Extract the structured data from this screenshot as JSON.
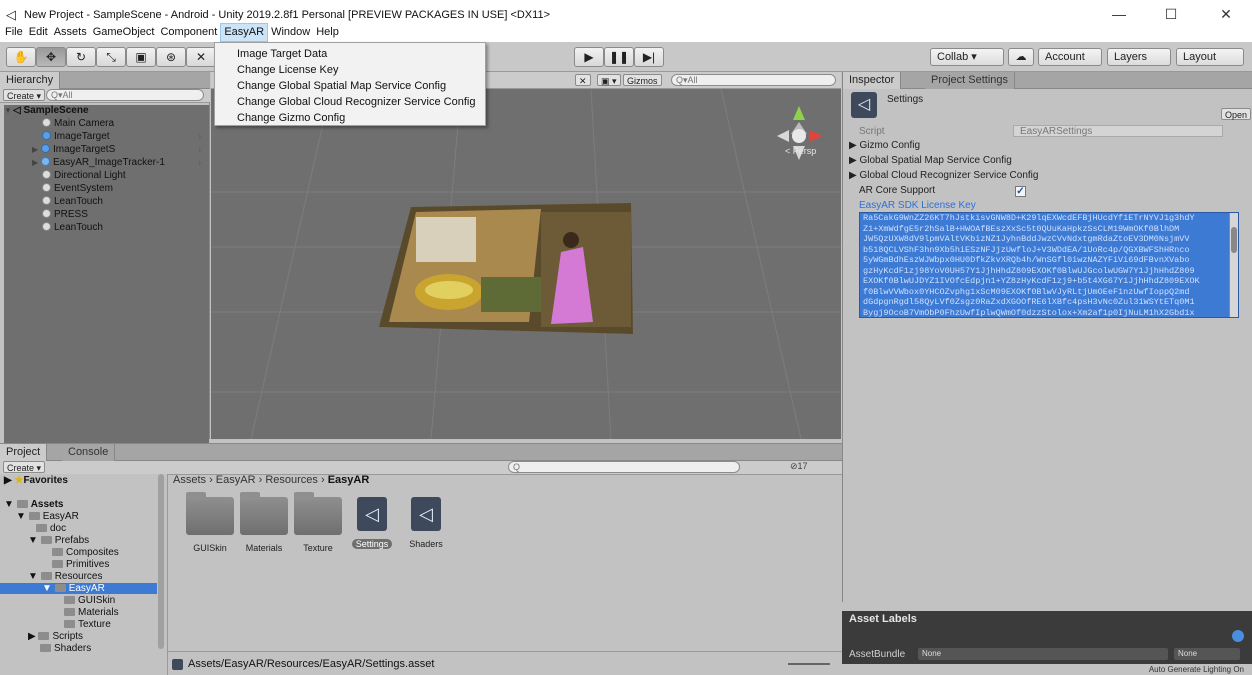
{
  "window": {
    "title": "New Project - SampleScene - Android - Unity 2019.2.8f1 Personal [PREVIEW PACKAGES IN USE] <DX11>",
    "minimize": "—",
    "maximize": "☐",
    "close": "✕"
  },
  "menubar": [
    "File",
    "Edit",
    "Assets",
    "GameObject",
    "Component",
    "EasyAR",
    "Window",
    "Help"
  ],
  "easyar_menu": [
    "Image Target Data",
    "Change License Key",
    "Change Global Spatial Map Service Config",
    "Change Global Cloud Recognizer Service Config",
    "Change Gizmo Config"
  ],
  "toolbar": {
    "collab": "Collab ▾",
    "account": "Account",
    "layers": "Layers",
    "layout": "Layout"
  },
  "hierarchy": {
    "tab": "Hierarchy",
    "create": "Create ▾",
    "search_placeholder": "Q▾All",
    "scene": "SampleScene",
    "items": [
      "Main Camera",
      "ImageTarget",
      "ImageTargetS",
      "EasyAR_ImageTracker-1",
      "Directional Light",
      "EventSystem",
      "LeanTouch",
      "PRESS",
      "LeanTouch"
    ]
  },
  "scene_view": {
    "gizmos": "Gizmos",
    "search_placeholder": "Q▾All",
    "persp": "< Persp"
  },
  "inspector": {
    "tab": "Inspector",
    "tab2": "Project Settings",
    "object_name": "Settings",
    "open": "Open",
    "script_label": "Script",
    "script_value": "EasyARSettings",
    "foldouts": [
      "Gizmo Config",
      "Global Spatial Map Service Config",
      "Global Cloud Recognizer Service Config"
    ],
    "ar_core_support": "AR Core Support",
    "license_label": "EasyAR SDK License Key",
    "license_lines": [
      "Ra5CakG9WnZZ26KT7hJstkisvGNW8D+K29lqEXWcdEFBjHUcdYf1ETrNYVJ1g3hdY",
      "Z1+XmWdfgE5r2hSalB+HWOAfBEszXxSc5t0QUuKaHpkzSsCLM19WmOKf0BlhDM",
      "JW5QzUXW8dV9lpmVAltVKbizNZ1JyhnBddJwzCVvNdxtgmRdaZtoEV3DM0NsjmVV",
      "b518QCLVShF3hn9Xb5hiESzNFJjzUwfloJ+V3WDdEA/1UoRc4p/QGXBWFShHRnco",
      "5yWGmBdhEszWJWbpx0HU0DfkZkvXRQb4h/WnSGfl0iwzNAZYFiVi69dFBvnXVabo",
      "gzHyKcdF1zj98YoV0UH57Y1JjhHhdZ809EXOKf0BlwUJGcolwUGW7Y1JjhHhdZ809",
      "EXOKf0BlwUJDYZ1IVOfcEdpjn1+YZ8zHyKcdF1zj9+b5t4XG67Y1JjhHhdZ809EXOK",
      "f0BlwVVWbox0YHCOZvphg1xScM09EXOKf0BlwVJyRLtjUmOEeF1nzUwfIoppQ2md",
      "dGdpgnRgdl58QyLVf0Zsgz0RaZxdXGOOfRE6lXBfc4psH3vNc0Zul31WSYtETq0M1",
      "Bygj9OcoB7VmObP0FhzUwfIplwQWmOf0dzzStolox+Xm2af1p0IjNuLM1hX2Gbd1x"
    ],
    "asset_labels": "Asset Labels",
    "asset_bundle": "AssetBundle",
    "asset_bundle_value": "None",
    "asset_bundle_variant": "None",
    "status": "Auto Generate Lighting On"
  },
  "project": {
    "tab": "Project",
    "tab2": "Console",
    "create": "Create ▾",
    "count": "17",
    "favorites": "Favorites",
    "tree": [
      {
        "label": "Assets",
        "level": 0,
        "bold": true,
        "arrow": "▼"
      },
      {
        "label": "EasyAR",
        "level": 1,
        "arrow": "▼"
      },
      {
        "label": "doc",
        "level": 2,
        "arrow": ""
      },
      {
        "label": "Prefabs",
        "level": 2,
        "arrow": "▼"
      },
      {
        "label": "Composites",
        "level": 3,
        "arrow": ""
      },
      {
        "label": "Primitives",
        "level": 3,
        "arrow": ""
      },
      {
        "label": "Resources",
        "level": 2,
        "arrow": "▼"
      },
      {
        "label": "EasyAR",
        "level": 3,
        "arrow": "▼",
        "selected": true
      },
      {
        "label": "GUISkin",
        "level": 4,
        "arrow": ""
      },
      {
        "label": "Materials",
        "level": 4,
        "arrow": ""
      },
      {
        "label": "Texture",
        "level": 4,
        "arrow": ""
      },
      {
        "label": "Scripts",
        "level": 2,
        "arrow": "▶"
      },
      {
        "label": "Shaders",
        "level": 2,
        "arrow": ""
      }
    ],
    "breadcrumb": [
      "Assets",
      "EasyAR",
      "Resources",
      "EasyAR"
    ],
    "assets": [
      {
        "label": "GUISkin",
        "kind": "folder"
      },
      {
        "label": "Materials",
        "kind": "folder"
      },
      {
        "label": "Texture",
        "kind": "folder"
      },
      {
        "label": "Settings",
        "kind": "unity",
        "selected": true
      },
      {
        "label": "Shaders",
        "kind": "unity"
      }
    ],
    "path": "Assets/EasyAR/Resources/EasyAR/Settings.asset"
  }
}
